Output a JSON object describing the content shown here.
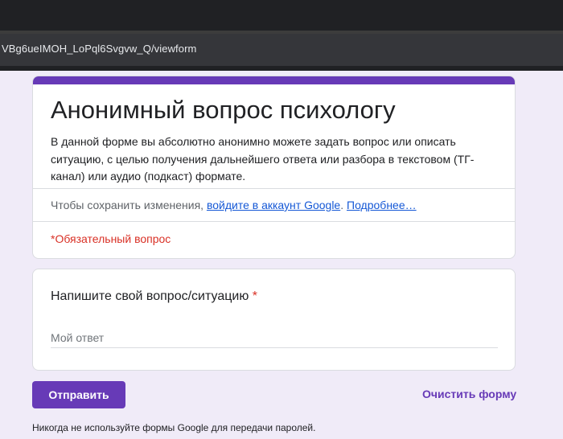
{
  "browser": {
    "address": "VBg6ueIMOH_LoPql6Svgvw_Q/viewform"
  },
  "form": {
    "title": "Анонимный вопрос психологу",
    "description": "В данной форме вы абсолютно анонимно можете задать вопрос или описать ситуацию, с целью получения дальнейшего ответа или разбора в текстовом (ТГ-канал) или аудио (подкаст) формате.",
    "signin_prefix": "Чтобы сохранить изменения, ",
    "signin_link": "войдите в аккаунт Google",
    "signin_sep": ". ",
    "more_link": "Подробнее…",
    "required_note": "*Обязательный вопрос"
  },
  "question": {
    "title": "Напишите свой вопрос/ситуацию",
    "required_mark": "*",
    "placeholder": "Мой ответ",
    "value": ""
  },
  "actions": {
    "submit_label": "Отправить",
    "clear_label": "Очистить форму"
  },
  "footer": {
    "note": "Никогда не используйте формы Google для передачи паролей."
  },
  "colors": {
    "accent": "#673ab7",
    "background": "#f0ebf8",
    "required": "#d93025",
    "link": "#1558d6"
  }
}
